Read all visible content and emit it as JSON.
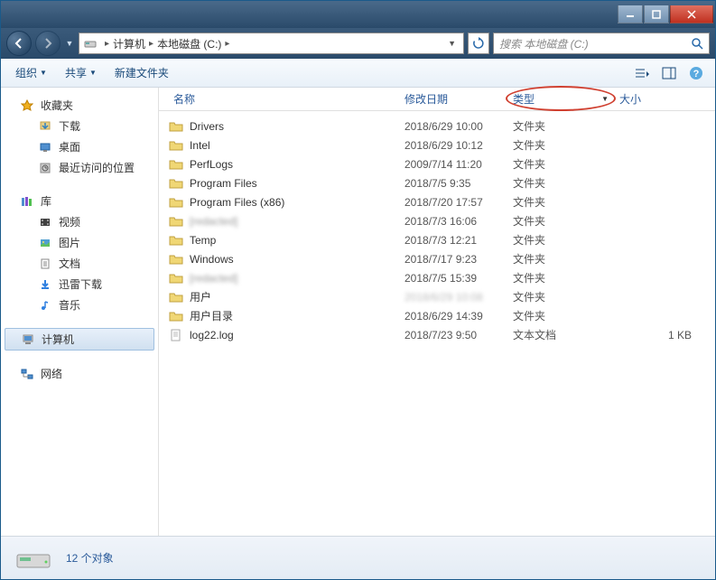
{
  "address": {
    "parts": [
      "计算机",
      "本地磁盘 (C:)"
    ]
  },
  "search": {
    "placeholder": "搜索 本地磁盘 (C:)"
  },
  "toolbar": {
    "organize": "组织",
    "share": "共享",
    "new_folder": "新建文件夹"
  },
  "sidebar": {
    "favorites": {
      "label": "收藏夹",
      "items": [
        "下载",
        "桌面",
        "最近访问的位置"
      ]
    },
    "libraries": {
      "label": "库",
      "items": [
        "视频",
        "图片",
        "文档",
        "迅雷下载",
        "音乐"
      ]
    },
    "computer": {
      "label": "计算机"
    },
    "network": {
      "label": "网络"
    }
  },
  "columns": {
    "name": "名称",
    "date": "修改日期",
    "type": "类型",
    "size": "大小"
  },
  "files": [
    {
      "icon": "folder",
      "name": "Drivers",
      "date": "2018/6/29 10:00",
      "type": "文件夹",
      "size": ""
    },
    {
      "icon": "folder",
      "name": "Intel",
      "date": "2018/6/29 10:12",
      "type": "文件夹",
      "size": ""
    },
    {
      "icon": "folder",
      "name": "PerfLogs",
      "date": "2009/7/14 11:20",
      "type": "文件夹",
      "size": ""
    },
    {
      "icon": "folder",
      "name": "Program Files",
      "date": "2018/7/5 9:35",
      "type": "文件夹",
      "size": ""
    },
    {
      "icon": "folder",
      "name": "Program Files (x86)",
      "date": "2018/7/20 17:57",
      "type": "文件夹",
      "size": ""
    },
    {
      "icon": "folder",
      "name": "[redacted]",
      "date": "2018/7/3 16:06",
      "type": "文件夹",
      "size": "",
      "blur": true
    },
    {
      "icon": "folder",
      "name": "Temp",
      "date": "2018/7/3 12:21",
      "type": "文件夹",
      "size": ""
    },
    {
      "icon": "folder",
      "name": "Windows",
      "date": "2018/7/17 9:23",
      "type": "文件夹",
      "size": ""
    },
    {
      "icon": "folder",
      "name": "[redacted]",
      "date": "2018/7/5 15:39",
      "type": "文件夹",
      "size": "",
      "blur": true
    },
    {
      "icon": "folder",
      "name": "用户",
      "date": "2018/6/29 10:08",
      "type": "文件夹",
      "size": "",
      "dateblur": true
    },
    {
      "icon": "folder",
      "name": "用户目录",
      "date": "2018/6/29 14:39",
      "type": "文件夹",
      "size": ""
    },
    {
      "icon": "file",
      "name": "log22.log",
      "date": "2018/7/23 9:50",
      "type": "文本文档",
      "size": "1 KB"
    }
  ],
  "status": {
    "count": "12 个对象"
  }
}
